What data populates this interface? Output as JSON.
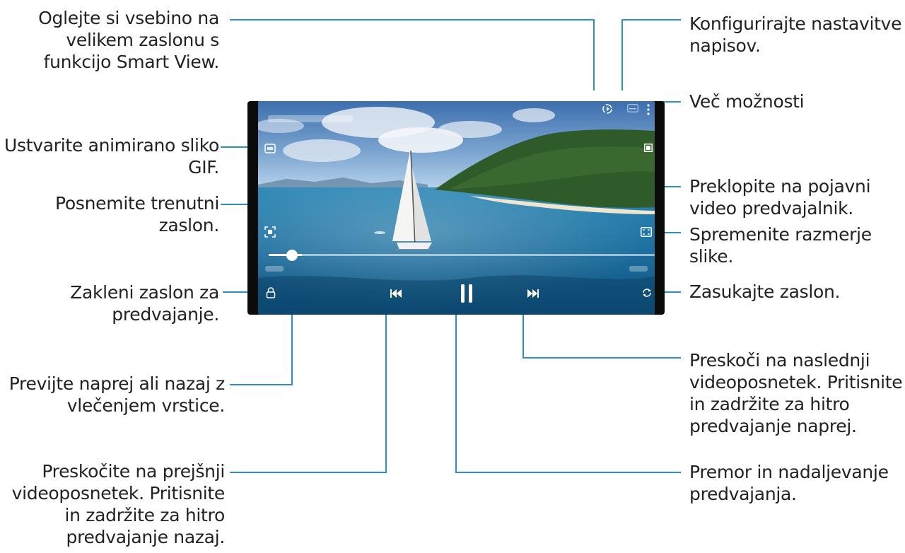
{
  "annotations": {
    "smart_view": [
      "Oglejte si vsebino na",
      "velikem zaslonu s",
      "funkcijo Smart View."
    ],
    "gif": [
      "Ustvarite animirano sliko",
      "GIF."
    ],
    "capture": [
      "Posnemite trenutni",
      "zaslon."
    ],
    "lock": [
      "Zakleni zaslon za",
      "predvajanje."
    ],
    "seek": [
      "Previjte naprej ali nazaj z",
      "vlečenjem vrstice."
    ],
    "previous": [
      "Preskočite na prejšnji",
      "videoposnetek. Pritisnite",
      "in zadržite za hitro",
      "predvajanje nazaj."
    ],
    "subtitles": [
      "Konfigurirajte nastavitve",
      "napisov."
    ],
    "more": [
      "Več možnosti"
    ],
    "popup": [
      "Preklopite na pojavni",
      "video predvajalnik."
    ],
    "ratio": [
      "Spremenite razmerje",
      "slike."
    ],
    "rotate": [
      "Zasukajte zaslon."
    ],
    "next": [
      "Preskoči na naslednji",
      "videoposnetek. Pritisnite",
      "in zadržite za hitro",
      "predvajanje naprej."
    ],
    "pause": [
      "Premor in nadaljevanje",
      "predvajanja."
    ]
  },
  "player": {
    "seek_progress": 0.085,
    "icons": [
      "gif-icon",
      "capture-icon",
      "lock-icon",
      "previous-icon",
      "pause-icon",
      "next-icon",
      "smart-view-icon",
      "subtitles-icon",
      "more-options-icon",
      "popup-player-icon",
      "aspect-ratio-icon",
      "rotate-icon"
    ]
  },
  "colors": {
    "leader": "#2b8fc8",
    "text": "#222222",
    "device": "#0b0b0b"
  }
}
